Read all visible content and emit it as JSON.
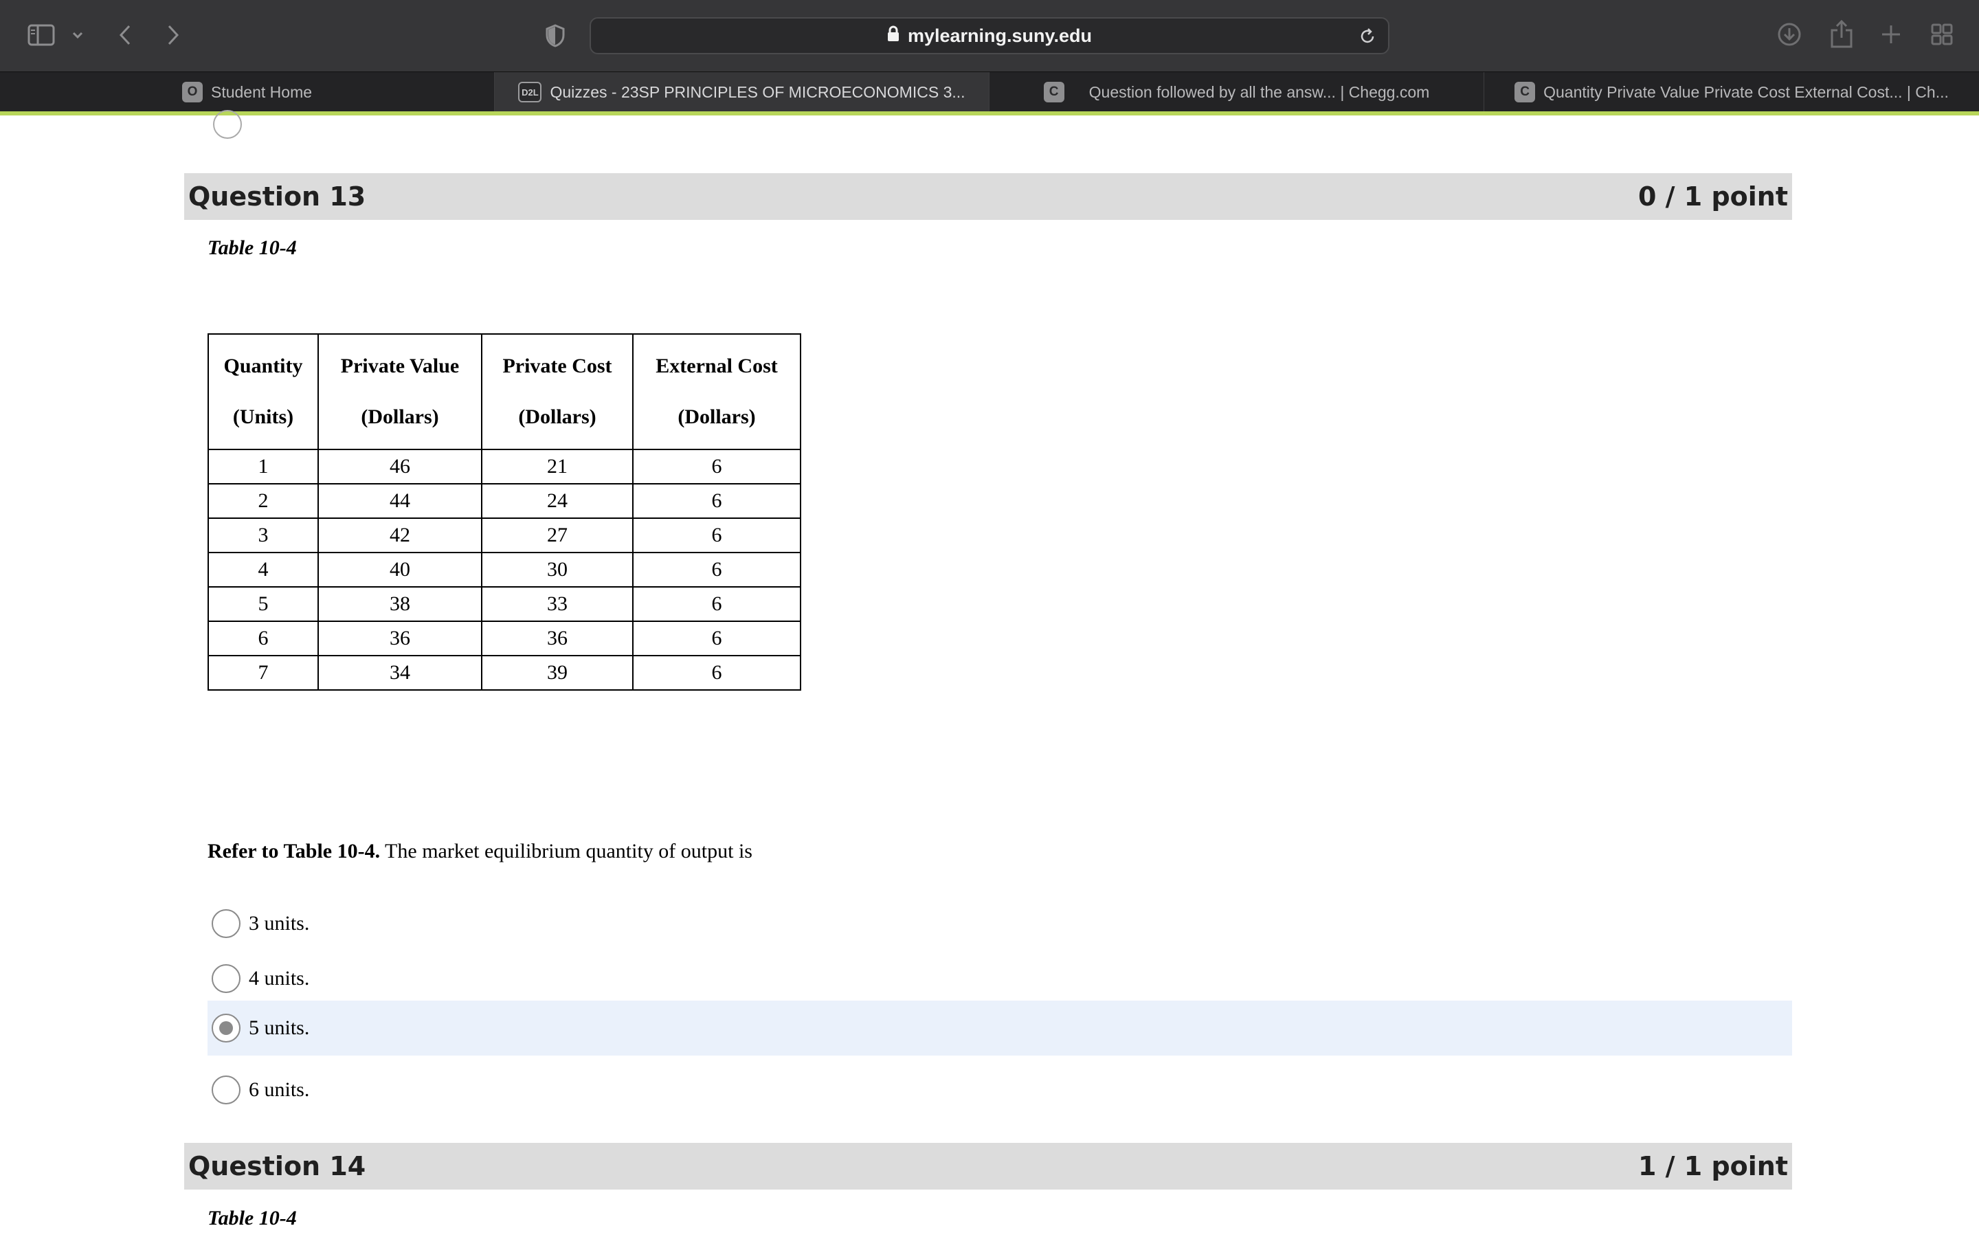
{
  "browser": {
    "url": "mylearning.suny.edu",
    "tabs": [
      {
        "favicon": "O",
        "label": "Student Home"
      },
      {
        "favicon": "D2L",
        "label": "Quizzes - 23SP PRINCIPLES OF MICROECONOMICS 3..."
      },
      {
        "favicon": "C",
        "label": "Question followed by all the answ... | Chegg.com"
      },
      {
        "favicon": "C",
        "label": "Quantity Private Value Private Cost External Cost... | Ch..."
      }
    ],
    "icons": [
      "sidebar-icon",
      "chevron-down-icon",
      "back-icon",
      "forward-icon",
      "shield-icon",
      "lock-icon",
      "reload-icon",
      "download-icon",
      "share-icon",
      "plus-icon",
      "tab-overview-icon"
    ],
    "accent_color": "#b8d65a"
  },
  "q13": {
    "title": "Question 13",
    "score": "0 / 1 point",
    "table_caption": "Table 10-4",
    "table": {
      "headers": [
        {
          "line1": "Quantity",
          "line2": "(Units)"
        },
        {
          "line1": "Private Value",
          "line2": "(Dollars)"
        },
        {
          "line1": "Private Cost",
          "line2": "(Dollars)"
        },
        {
          "line1": "External Cost",
          "line2": "(Dollars)"
        }
      ],
      "rows": [
        [
          "1",
          "46",
          "21",
          "6"
        ],
        [
          "2",
          "44",
          "24",
          "6"
        ],
        [
          "3",
          "42",
          "27",
          "6"
        ],
        [
          "4",
          "40",
          "30",
          "6"
        ],
        [
          "5",
          "38",
          "33",
          "6"
        ],
        [
          "6",
          "36",
          "36",
          "6"
        ],
        [
          "7",
          "34",
          "39",
          "6"
        ]
      ]
    },
    "prompt_bold": "Refer to Table 10-4.",
    "prompt_text": " The market equilibrium quantity of output is",
    "options": [
      "3 units.",
      "4 units.",
      "5 units.",
      "6 units."
    ],
    "selected_option": "5 units."
  },
  "q14": {
    "title": "Question 14",
    "score": "1 / 1 point",
    "table_caption": "Table 10-4"
  }
}
